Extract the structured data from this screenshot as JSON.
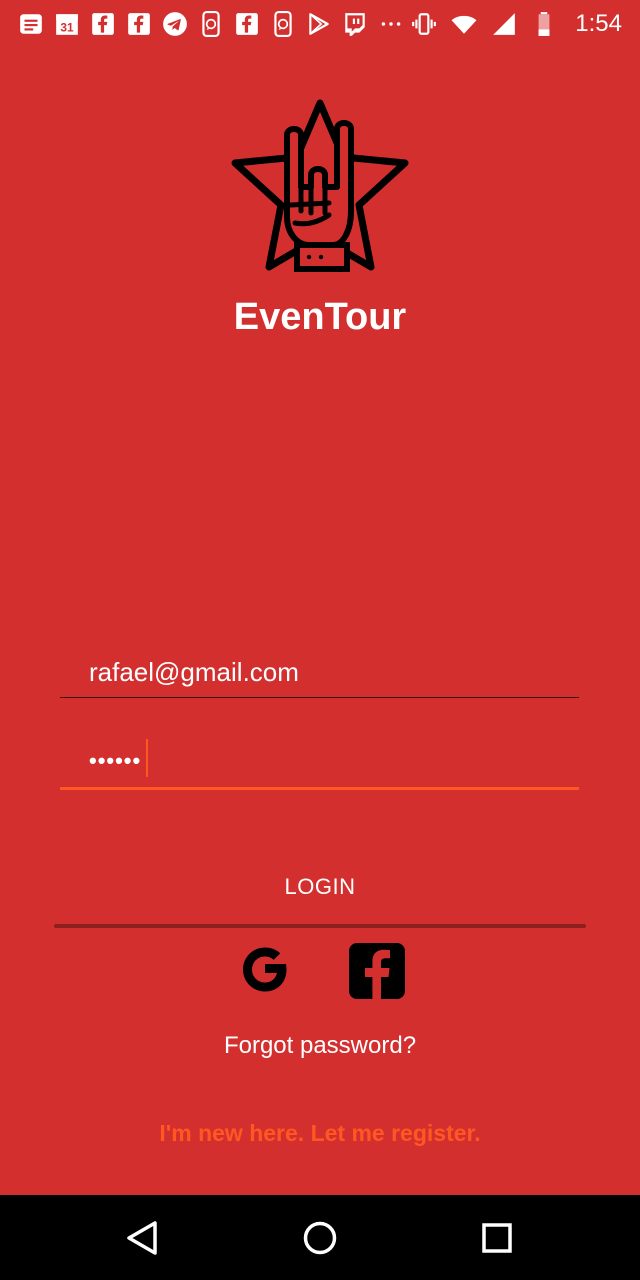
{
  "status_bar": {
    "time": "1:54",
    "notification_icons": [
      "message-icon",
      "calendar-icon",
      "facebook-icon",
      "facebook-icon",
      "telegram-icon",
      "whatsapp-icon",
      "facebook-icon",
      "whatsapp-icon",
      "play-store-icon",
      "twitch-icon",
      "more-icon"
    ],
    "calendar_day": "31",
    "system_icons": [
      "vibrate-icon",
      "wifi-icon",
      "signal-icon",
      "battery-icon"
    ]
  },
  "app": {
    "title": "EvenTour"
  },
  "login_form": {
    "email_value": "rafael@gmail.com",
    "password_masked": "••••••",
    "login_label": "LOGIN",
    "forgot_label": "Forgot password?",
    "register_label": "I'm new here. Let me register."
  },
  "colors": {
    "background": "#D32F2F",
    "accent": "#FF5722",
    "text": "#FFFFFF"
  },
  "social": [
    "google-icon",
    "facebook-icon"
  ],
  "nav": [
    "back-icon",
    "home-icon",
    "recent-apps-icon"
  ]
}
